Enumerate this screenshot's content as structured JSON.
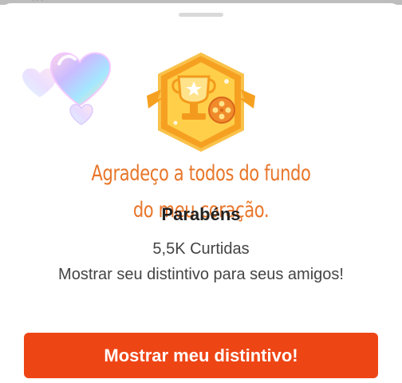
{
  "background_peek": {
    "text": "· · ·"
  },
  "badge": {
    "icons": [
      "trophy-icon",
      "film-reel-icon",
      "star-icon"
    ],
    "colors": {
      "hex": "#f6a021",
      "inner": "#ffcf4a",
      "film": "#f08a2b"
    }
  },
  "decor": {
    "icon": "hearts-icon"
  },
  "message": {
    "line1": "Agradeço a todos do fundo",
    "line2": "do meu coração.",
    "color": "#e8762a"
  },
  "title": "Parabéns",
  "likes": "5,5K Curtidas",
  "description": "Mostrar seu distintivo para seus amigos!",
  "cta": {
    "label": "Mostrar meu distintivo!",
    "color": "#ee4515"
  }
}
